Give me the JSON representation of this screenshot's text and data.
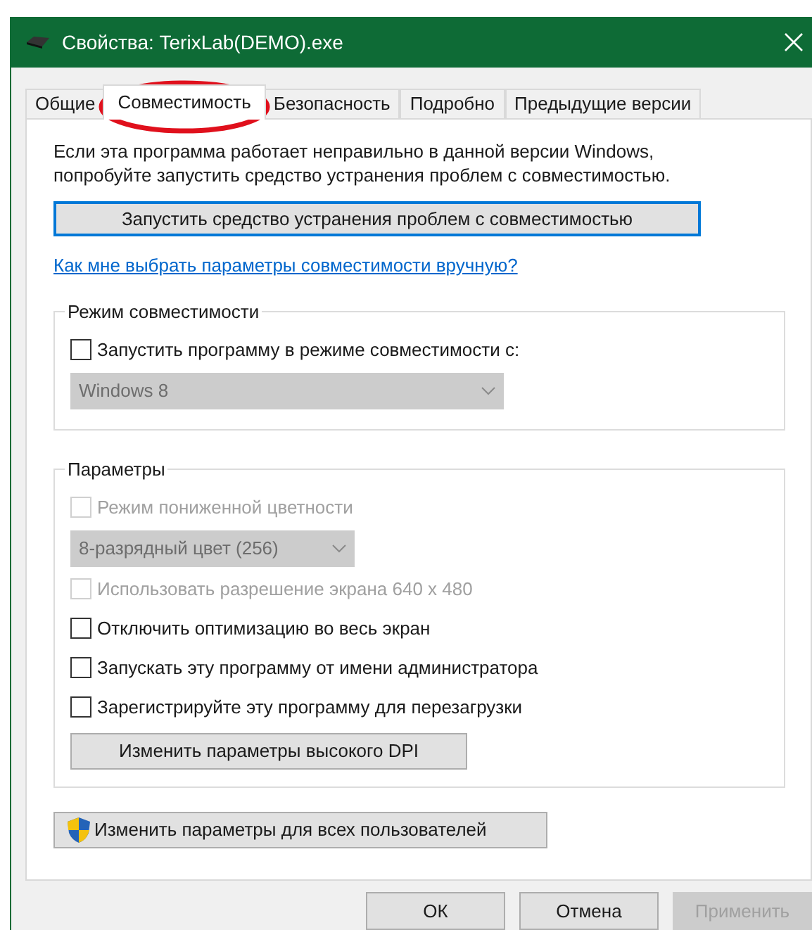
{
  "window": {
    "title": "Свойства: TerixLab(DEMO).exe"
  },
  "tabs": [
    {
      "label": "Общие",
      "selected": false
    },
    {
      "label": "Совместимость",
      "selected": true
    },
    {
      "label": "Безопасность",
      "selected": false
    },
    {
      "label": "Подробно",
      "selected": false
    },
    {
      "label": "Предыдущие версии",
      "selected": false
    }
  ],
  "intro": "Если эта программа работает неправильно в данной версии Windows, попробуйте запустить средство устранения проблем с совместимостью.",
  "troubleshoot_button": "Запустить средство устранения проблем с совместимостью",
  "help_link": "Как мне выбрать параметры совместимости вручную?",
  "groups": [
    {
      "title": "Режим совместимости",
      "items": [
        {
          "kind": "checkbox",
          "label": "Запустить программу в режиме совместимости с:",
          "checked": false,
          "disabled": false
        },
        {
          "kind": "dropdown",
          "value": "Windows 8",
          "disabled": true
        }
      ]
    },
    {
      "title": "Параметры",
      "items": [
        {
          "kind": "checkbox",
          "label": "Режим пониженной цветности",
          "checked": false,
          "disabled": true
        },
        {
          "kind": "dropdown",
          "value": "8-разрядный цвет (256)",
          "disabled": true
        },
        {
          "kind": "checkbox",
          "label": "Использовать разрешение экрана 640 x 480",
          "checked": false,
          "disabled": true
        },
        {
          "kind": "checkbox",
          "label": "Отключить оптимизацию во весь экран",
          "checked": false,
          "disabled": false
        },
        {
          "kind": "checkbox",
          "label": "Запускать эту программу от имени администратора",
          "checked": false,
          "disabled": false
        },
        {
          "kind": "checkbox",
          "label": "Зарегистрируйте эту программу для перезагрузки",
          "checked": false,
          "disabled": false
        },
        {
          "kind": "button",
          "label": "Изменить параметры высокого DPI",
          "disabled": false
        }
      ]
    }
  ],
  "all_users_button": "Изменить параметры для всех пользователей",
  "dialog_buttons": [
    {
      "label": "ОК",
      "disabled": false
    },
    {
      "label": "Отмена",
      "disabled": false
    },
    {
      "label": "Применить",
      "disabled": true
    }
  ]
}
